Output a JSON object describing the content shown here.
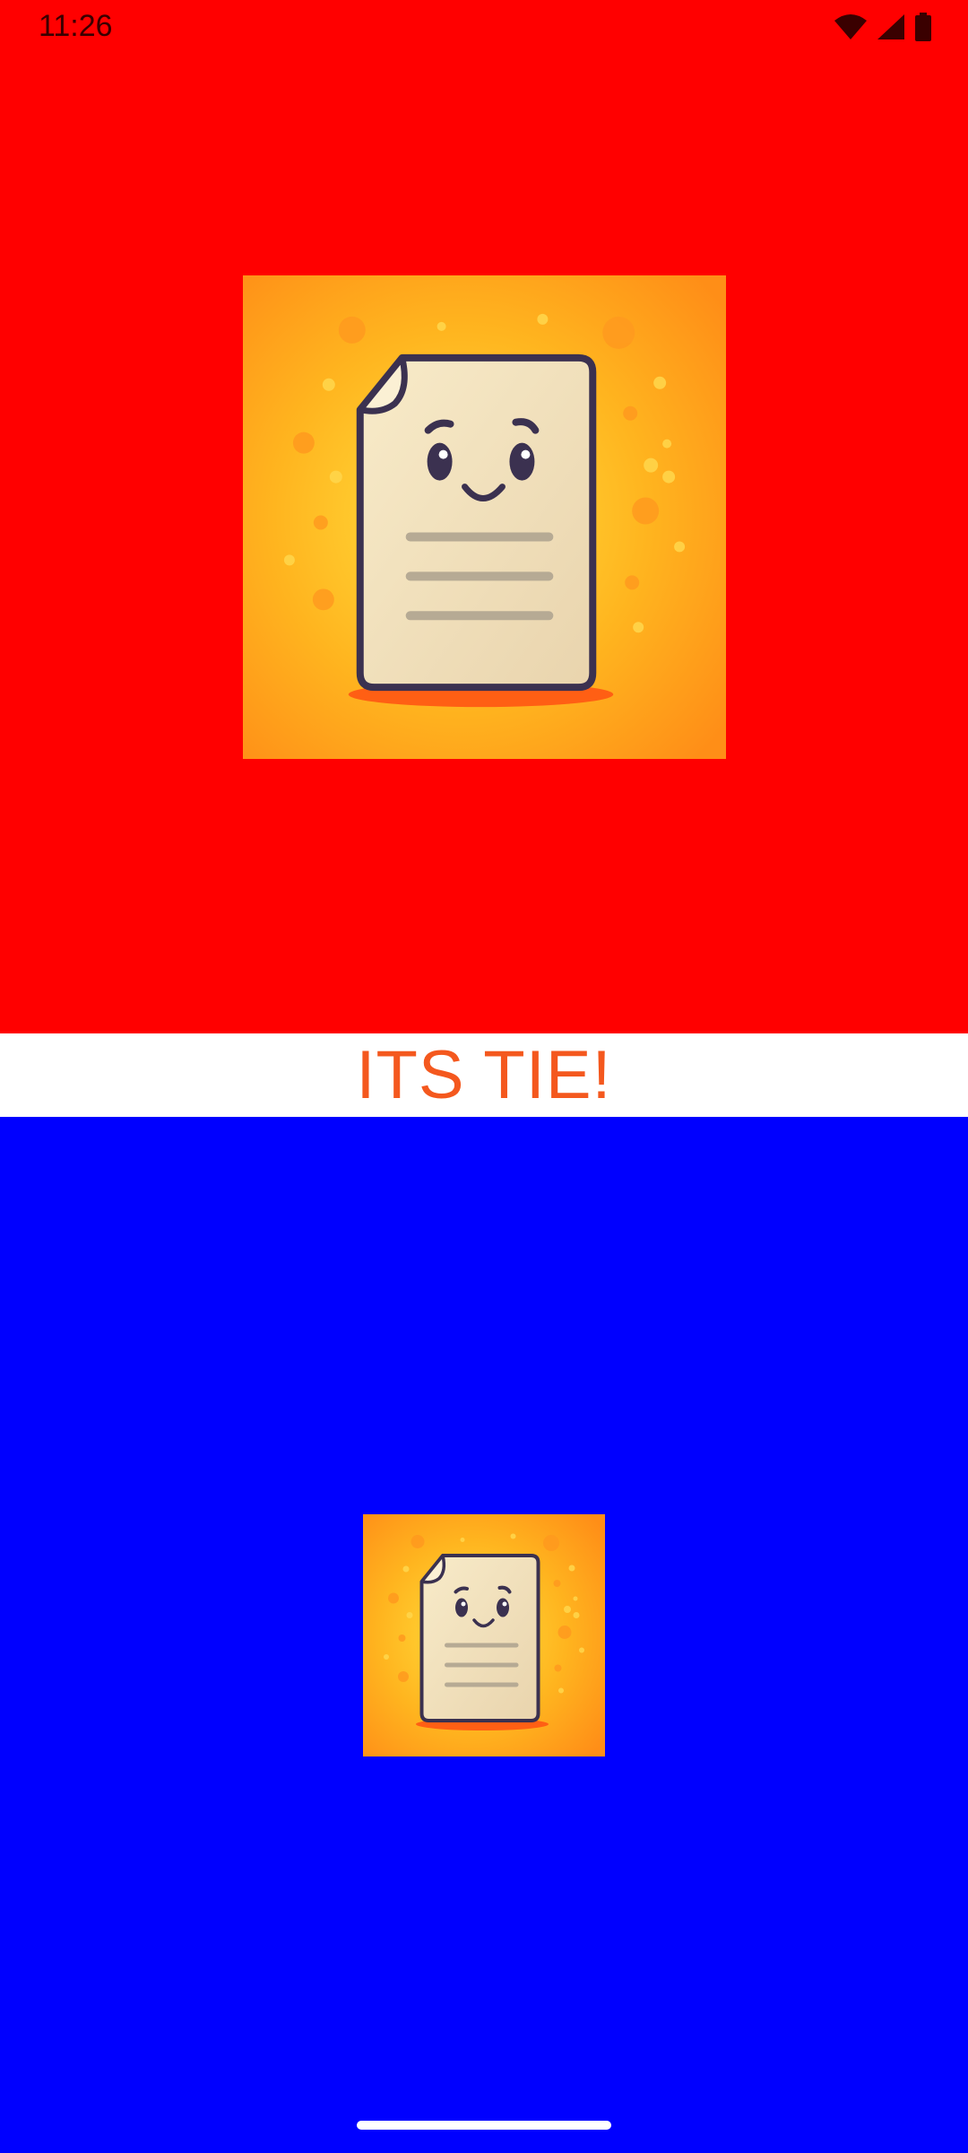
{
  "status_bar": {
    "time": "11:26",
    "icons": [
      "wifi-icon",
      "cell-signal-icon",
      "battery-icon"
    ]
  },
  "top_player": {
    "background": "#ff0000",
    "choice_icon": "paper-icon"
  },
  "result": {
    "text": "ITS TIE!",
    "color": "#f4581e"
  },
  "bottom_player": {
    "background": "#0000ff",
    "choice_icon": "paper-icon"
  },
  "colors": {
    "card_glow": "#ffd93a",
    "card_edge": "#ff8c1a",
    "paper": "#f3e3bd",
    "outline": "#3b3150"
  }
}
